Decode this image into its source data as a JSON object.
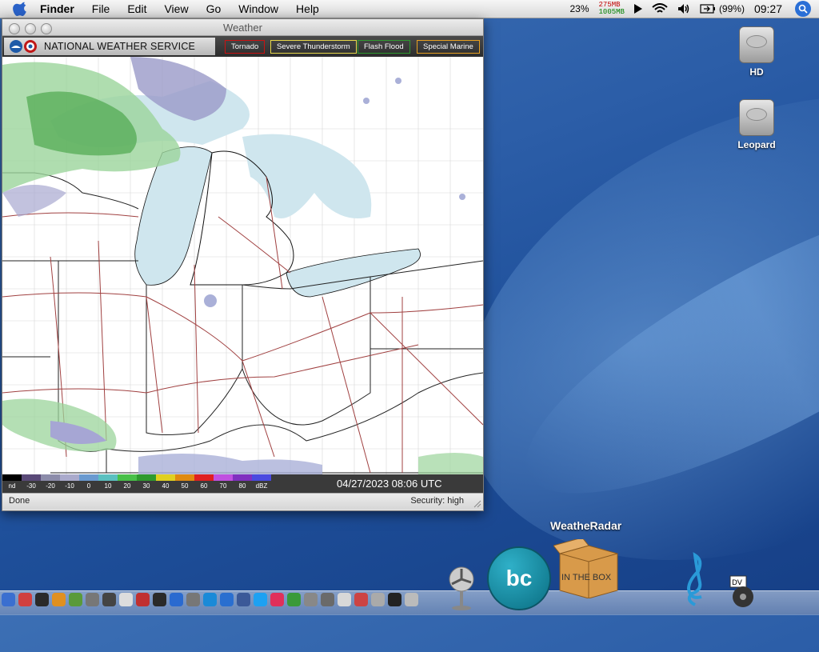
{
  "menubar": {
    "app": "Finder",
    "items": [
      "File",
      "Edit",
      "View",
      "Go",
      "Window",
      "Help"
    ],
    "cpu": "23%",
    "mem_used": "275MB",
    "mem_free": "1005MB",
    "battery": "(99%)",
    "clock": "09:27"
  },
  "window": {
    "title": "Weather",
    "brand": "NATIONAL WEATHER SERVICE",
    "warnings": [
      {
        "label": "Tornado",
        "color": "#cc1111"
      },
      {
        "label": "Severe Thunderstorm",
        "color": "#e8d84a"
      },
      {
        "label": "Flash Flood",
        "color": "#2f9b2f"
      },
      {
        "label": "Special Marine",
        "color": "#e8a020"
      }
    ],
    "legend": {
      "labels": [
        "nd",
        "-30",
        "-20",
        "-10",
        "0",
        "10",
        "20",
        "30",
        "40",
        "50",
        "60",
        "70",
        "80",
        "dBZ"
      ],
      "colors": [
        "#000000",
        "#5a4a78",
        "#8c8caa",
        "#aaaacc",
        "#6a9ad0",
        "#5ac0c0",
        "#48c048",
        "#2e9a2e",
        "#e0d020",
        "#e08a10",
        "#e02020",
        "#c050e0",
        "#8030c0",
        "#4a4ae0"
      ]
    },
    "timestamp": "04/27/2023 08:06 UTC",
    "status_left": "Done",
    "status_right": "Security: high"
  },
  "desktop": {
    "icons": [
      "HD",
      "Leopard"
    ]
  },
  "dock": {
    "highlighted_label": "WeatheRadar",
    "bc_text": "bc",
    "box_text": "IN THE BOX"
  }
}
